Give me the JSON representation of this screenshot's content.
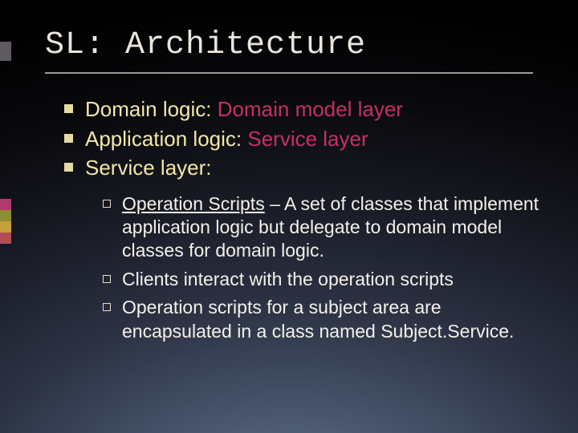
{
  "title": "SL: Architecture",
  "bullets": {
    "b1_pre": "Domain logic:",
    "b1_hi": "Domain model layer",
    "b2_pre": "Application logic:",
    "b2_hi": "Service layer",
    "b3": "Service layer:"
  },
  "sub": {
    "s1_term": "Operation Scripts",
    "s1_rest": " – A set of classes that implement application logic but delegate to domain model classes for domain logic.",
    "s2": "Clients interact with the operation scripts",
    "s3": "Operation scripts for a subject area are encapsulated in a class named Subject.Service."
  }
}
